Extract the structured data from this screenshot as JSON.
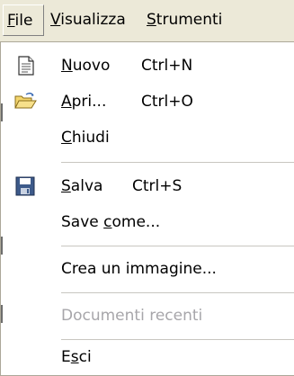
{
  "menubar": {
    "file": {
      "mnemonic": "F",
      "rest": "ile"
    },
    "visualizza": {
      "mnemonic": "V",
      "rest": "isualizza"
    },
    "strumenti": {
      "mnemonic": "S",
      "rest": "trumenti"
    }
  },
  "menu": {
    "nuovo": {
      "pre": "",
      "mnemonic": "N",
      "post": "uovo",
      "shortcut": "Ctrl+N",
      "icon": "new-document-icon"
    },
    "apri": {
      "pre": "",
      "mnemonic": "A",
      "post": "pri...",
      "shortcut": "Ctrl+O",
      "icon": "open-folder-icon"
    },
    "chiudi": {
      "pre": "",
      "mnemonic": "C",
      "post": "hiudi"
    },
    "salva": {
      "pre": "",
      "mnemonic": "S",
      "post": "alva",
      "shortcut": "Ctrl+S",
      "icon": "floppy-disk-icon"
    },
    "save_come": {
      "pre": "Save ",
      "mnemonic": "c",
      "post": "ome..."
    },
    "crea_immagine": {
      "label": "Crea un immagine..."
    },
    "documenti_recenti": {
      "label": "Documenti recenti"
    },
    "esci": {
      "pre": "E",
      "mnemonic": "s",
      "post": "ci"
    }
  },
  "colors": {
    "menubar_bg": "#ece9d8",
    "menu_bg": "#ffffff",
    "disabled_text": "#a7a6aa",
    "separator": "#c8c6c0"
  }
}
